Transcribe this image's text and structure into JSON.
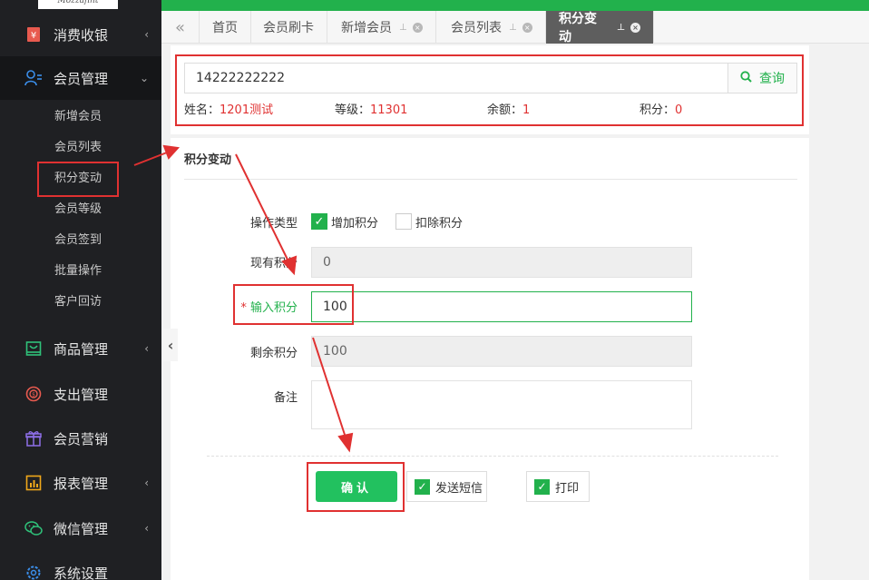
{
  "sidebar": {
    "logo_text": "Mozzafint",
    "menu": [
      {
        "label": "消费收银",
        "icon": "cashier-icon",
        "arrow": "‹"
      },
      {
        "label": "会员管理",
        "icon": "member-icon",
        "arrow": "⌄"
      },
      {
        "label": "商品管理",
        "icon": "goods-icon",
        "arrow": "‹"
      },
      {
        "label": "支出管理",
        "icon": "expense-icon",
        "arrow": ""
      },
      {
        "label": "会员营销",
        "icon": "gift-icon",
        "arrow": ""
      },
      {
        "label": "报表管理",
        "icon": "report-icon",
        "arrow": "‹"
      },
      {
        "label": "微信管理",
        "icon": "wechat-icon",
        "arrow": "‹"
      },
      {
        "label": "系统设置",
        "icon": "settings-icon",
        "arrow": ""
      }
    ],
    "submenu": [
      "新增会员",
      "会员列表",
      "积分变动",
      "会员等级",
      "会员签到",
      "批量操作",
      "客户回访"
    ]
  },
  "tabs": [
    {
      "label": "首页"
    },
    {
      "label": "会员刷卡"
    },
    {
      "label": "新增会员"
    },
    {
      "label": "会员列表"
    },
    {
      "label": "积分变动"
    }
  ],
  "search": {
    "value": "14222222222",
    "button_label": "查询"
  },
  "member_info": {
    "name_label": "姓名：",
    "name_value": "1201测试",
    "level_label": "等级：",
    "level_value": "11301",
    "balance_label": "余额：",
    "balance_value": "1",
    "points_label": "积分：",
    "points_value": "0"
  },
  "form": {
    "section_title": "积分变动",
    "op_type_label": "操作类型",
    "op_add_label": "增加积分",
    "op_deduct_label": "扣除积分",
    "current_points_label": "现有积分",
    "current_points_value": "0",
    "input_points_label": "输入积分",
    "input_points_value": "100",
    "remaining_points_label": "剩余积分",
    "remaining_points_value": "100",
    "remark_label": "备注",
    "confirm_label": "确认",
    "sms_label": "发送短信",
    "print_label": "打印"
  },
  "colors": {
    "accent": "#22b14c",
    "highlight": "#e03131"
  }
}
